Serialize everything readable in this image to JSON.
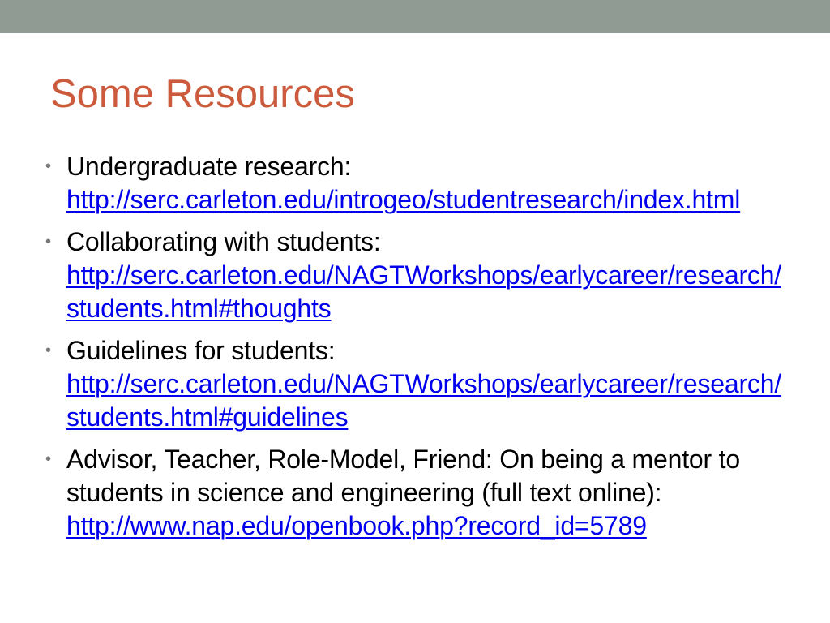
{
  "slide": {
    "title": "Some Resources",
    "colors": {
      "top_bar": "#909b94",
      "title": "#cc5a3c",
      "link": "#0000ee",
      "bullet": "#777777",
      "text": "#000000"
    },
    "items": [
      {
        "text": "Undergraduate research:",
        "link": "http://serc.carleton.edu/introgeo/studentresearch/index.html"
      },
      {
        "text": "Collaborating with students:",
        "link": "http://serc.carleton.edu/NAGTWorkshops/earlycareer/research/students.html#thoughts"
      },
      {
        "text": "Guidelines for students:",
        "link": "http://serc.carleton.edu/NAGTWorkshops/earlycareer/research/students.html#guidelines"
      },
      {
        "text": "Advisor, Teacher, Role-Model, Friend: On being a mentor to students in science and engineering (full text online):",
        "link": "http://www.nap.edu/openbook.php?record_id=5789"
      }
    ]
  }
}
